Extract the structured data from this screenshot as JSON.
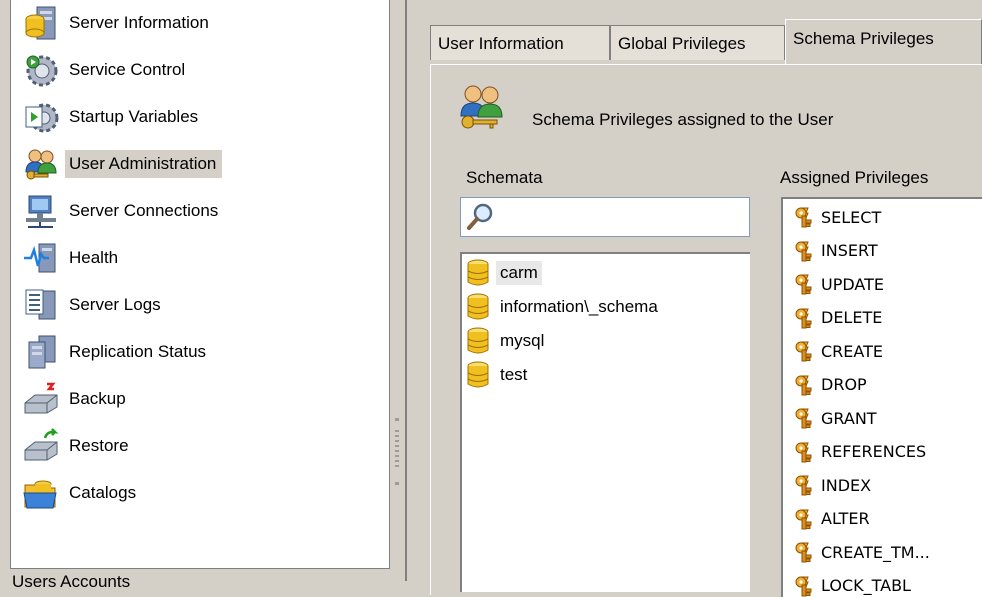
{
  "nav": {
    "items": [
      {
        "label": "Server Information",
        "icon": "database-server-icon"
      },
      {
        "label": "Service Control",
        "icon": "gear-icon"
      },
      {
        "label": "Startup Variables",
        "icon": "settings-gear-icon"
      },
      {
        "label": "User Administration",
        "icon": "users-icon",
        "selected": true
      },
      {
        "label": "Server Connections",
        "icon": "network-computer-icon"
      },
      {
        "label": "Health",
        "icon": "heartbeat-icon"
      },
      {
        "label": "Server Logs",
        "icon": "log-list-icon"
      },
      {
        "label": "Replication Status",
        "icon": "replication-servers-icon"
      },
      {
        "label": "Backup",
        "icon": "backup-drive-icon"
      },
      {
        "label": "Restore",
        "icon": "restore-drive-icon"
      },
      {
        "label": "Catalogs",
        "icon": "folder-database-icon"
      }
    ],
    "users_accounts_label": "Users Accounts"
  },
  "tabs": [
    {
      "label": "User Information"
    },
    {
      "label": "Global Privileges"
    },
    {
      "label": "Schema Privileges",
      "active": true
    }
  ],
  "header": {
    "text": "Schema Privileges assigned to the User",
    "icon": "users-key-icon"
  },
  "schemata": {
    "label": "Schemata",
    "search": {
      "value": "",
      "placeholder": "",
      "icon": "search-icon"
    },
    "items": [
      {
        "label": "carm",
        "selected": true
      },
      {
        "label": "information\\_schema"
      },
      {
        "label": "mysql"
      },
      {
        "label": "test"
      }
    ]
  },
  "privileges": {
    "label": "Assigned Privileges",
    "items": [
      "SELECT",
      "INSERT",
      "UPDATE",
      "DELETE",
      "CREATE",
      "DROP",
      "GRANT",
      "REFERENCES",
      "INDEX",
      "ALTER",
      "CREATE_TM...",
      "LOCK_TABL"
    ]
  },
  "colors": {
    "panel": "#d4d0c8",
    "selected": "#d4d0c8",
    "db_icon": "#f0c020",
    "key_icon": "#d9a030"
  }
}
